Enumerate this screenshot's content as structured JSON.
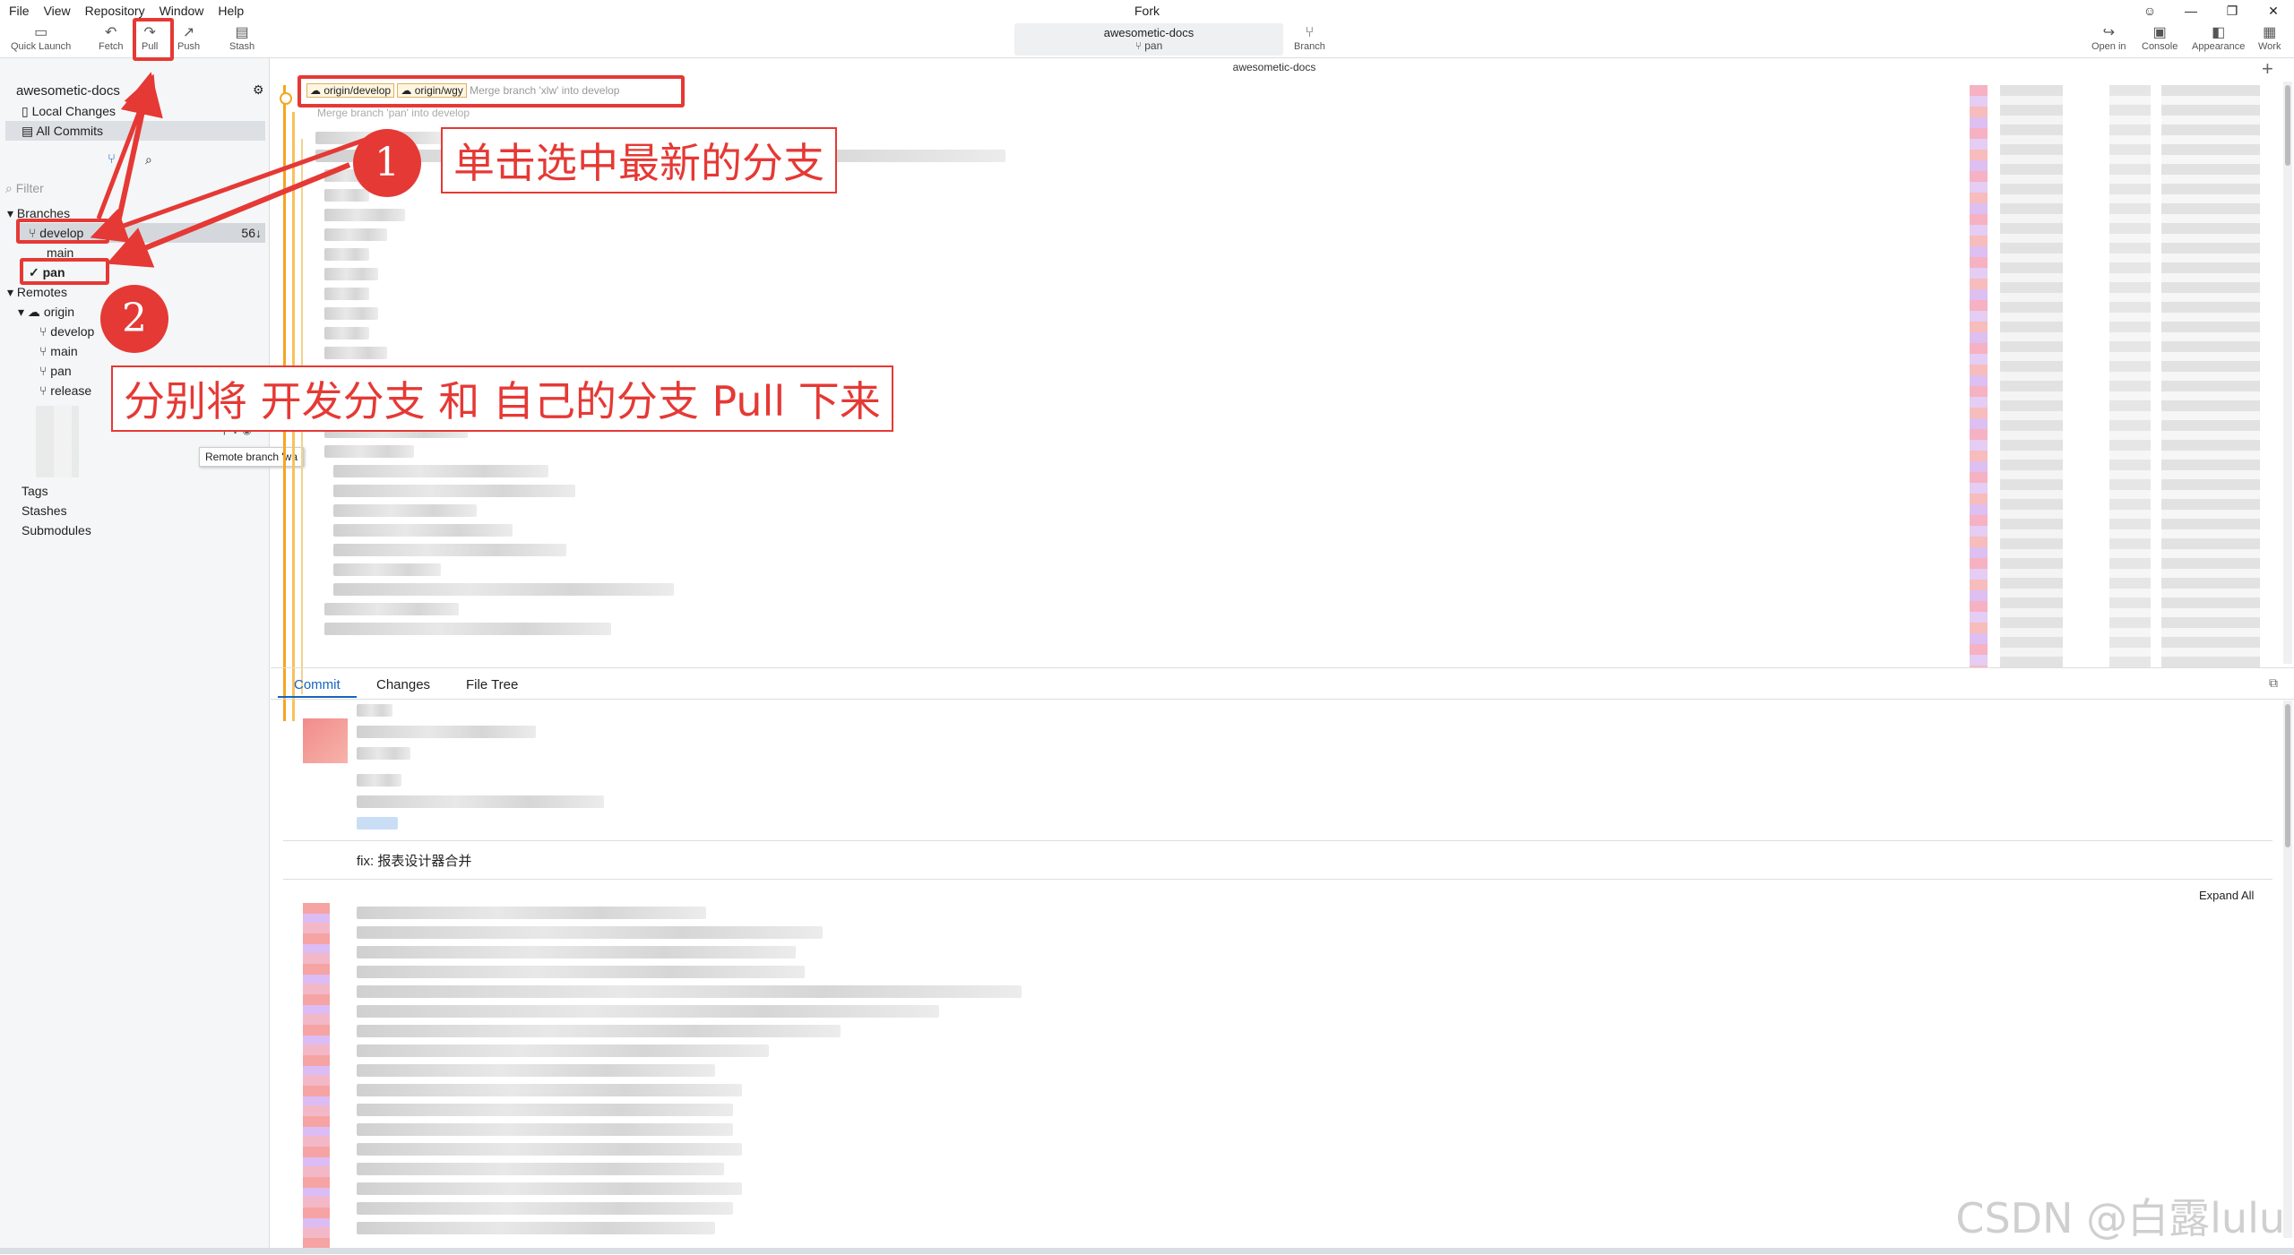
{
  "app": {
    "title": "Fork"
  },
  "menu": [
    "File",
    "View",
    "Repository",
    "Window",
    "Help"
  ],
  "toolbar": {
    "quick_launch": "Quick Launch",
    "fetch": "Fetch",
    "pull": "Pull",
    "push": "Push",
    "stash": "Stash",
    "branch": "Branch",
    "open_in": "Open in",
    "console": "Console",
    "appearance": "Appearance",
    "work": "Work"
  },
  "repo_selector": {
    "repo": "awesometic-docs",
    "branch": "pan"
  },
  "path_label": "awesometic-docs",
  "sidebar": {
    "repo_name": "awesometic-docs",
    "local_changes": "Local Changes",
    "all_commits": "All Commits",
    "filter_placeholder": "Filter",
    "branches_header": "Branches",
    "branches": [
      {
        "name": "develop",
        "count": "56↓"
      },
      {
        "name": "main"
      },
      {
        "name": "pan"
      }
    ],
    "remotes_header": "Remotes",
    "remote_name": "origin",
    "remote_branches": [
      "develop",
      "main",
      "pan",
      "release"
    ],
    "tags": "Tags",
    "stashes": "Stashes",
    "submodules": "Submodules",
    "tooltip": "Remote branch 'wa"
  },
  "commits": {
    "first_tags": [
      "origin/develop",
      "origin/wgy"
    ],
    "first_message": "Merge branch 'xlw' into develop",
    "second_message": "Merge branch 'pan' into develop"
  },
  "bottom": {
    "tabs": [
      "Commit",
      "Changes",
      "File Tree"
    ],
    "commit_message": "fix: 报表设计器合并",
    "expand_all": "Expand All"
  },
  "annotations": {
    "step1_num": "1",
    "step1_text": "单击选中最新的分支",
    "step2_num": "2",
    "step2_text": "分别将 开发分支 和 自己的分支 Pull 下来"
  },
  "watermark": "CSDN @白露lulu",
  "colors": {
    "accent": "#1565c0",
    "annotation_red": "#e53935",
    "graph_orange": "#f5a623"
  }
}
